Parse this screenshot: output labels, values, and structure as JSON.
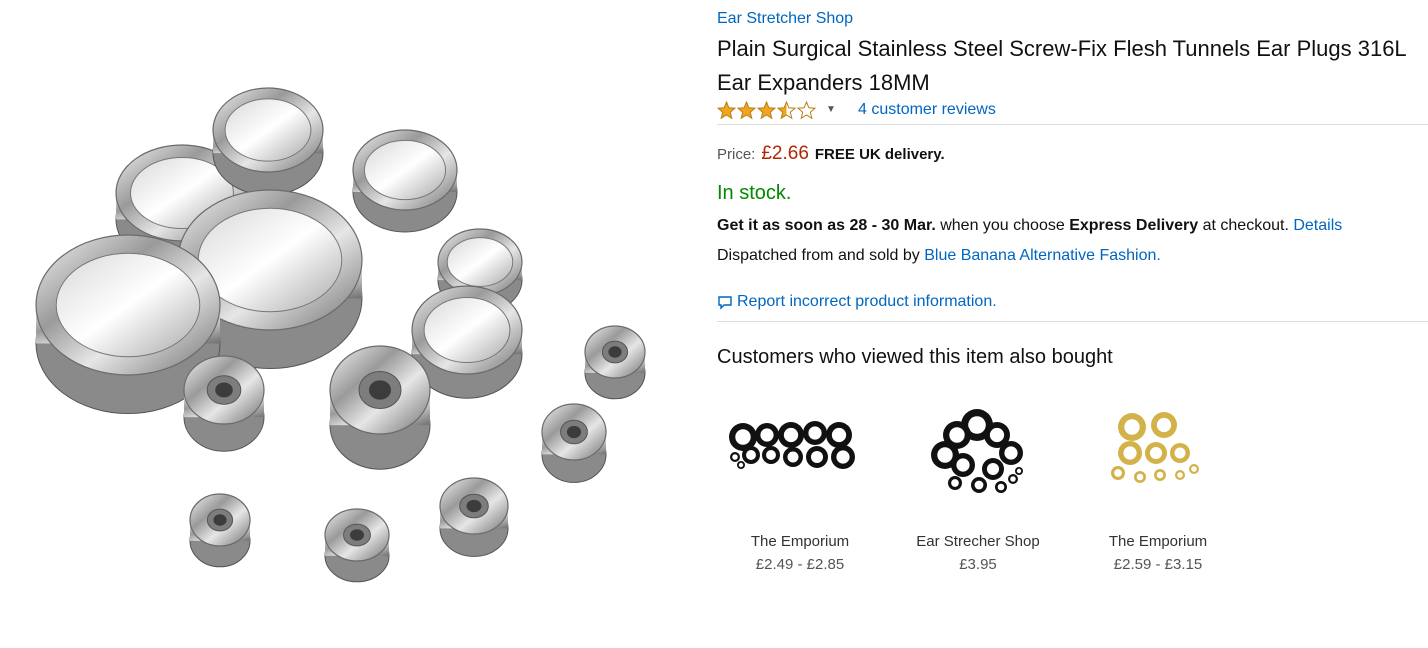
{
  "product": {
    "brand": "Ear Stretcher Shop",
    "title": "Plain Surgical Stainless Steel Screw-Fix Flesh Tunnels Ear Plugs 316L Ear Expanders 18MM",
    "rating_stars": 3.5,
    "reviews_label": "4 customer reviews",
    "price_label": "Price:",
    "price": "£2.66",
    "free_delivery": "FREE UK delivery.",
    "stock": "In stock.",
    "delivery": {
      "intro": "Get it as soon as 28 - 30 Mar.",
      "mid": " when you choose ",
      "express": "Express Delivery",
      "tail": " at checkout. ",
      "details_link": "Details"
    },
    "dispatch": {
      "intro": "Dispatched from and sold by ",
      "seller_link": "Blue Banana Alternative Fashion",
      "tail": "."
    },
    "report_link": "Report incorrect product information."
  },
  "also_bought": {
    "heading": "Customers who viewed this item also bought",
    "items": [
      {
        "seller": "The Emporium",
        "price": "£2.49 - £2.85",
        "color": "#111111"
      },
      {
        "seller": "Ear Strecher Shop",
        "price": "£3.95",
        "color": "#111111"
      },
      {
        "seller": "The Emporium",
        "price": "£2.59 - £3.15",
        "color": "#d4b24a"
      }
    ]
  },
  "colors": {
    "link": "#0066c0",
    "price": "#b12704",
    "stock": "#008a00",
    "star": "#f0a51f"
  }
}
